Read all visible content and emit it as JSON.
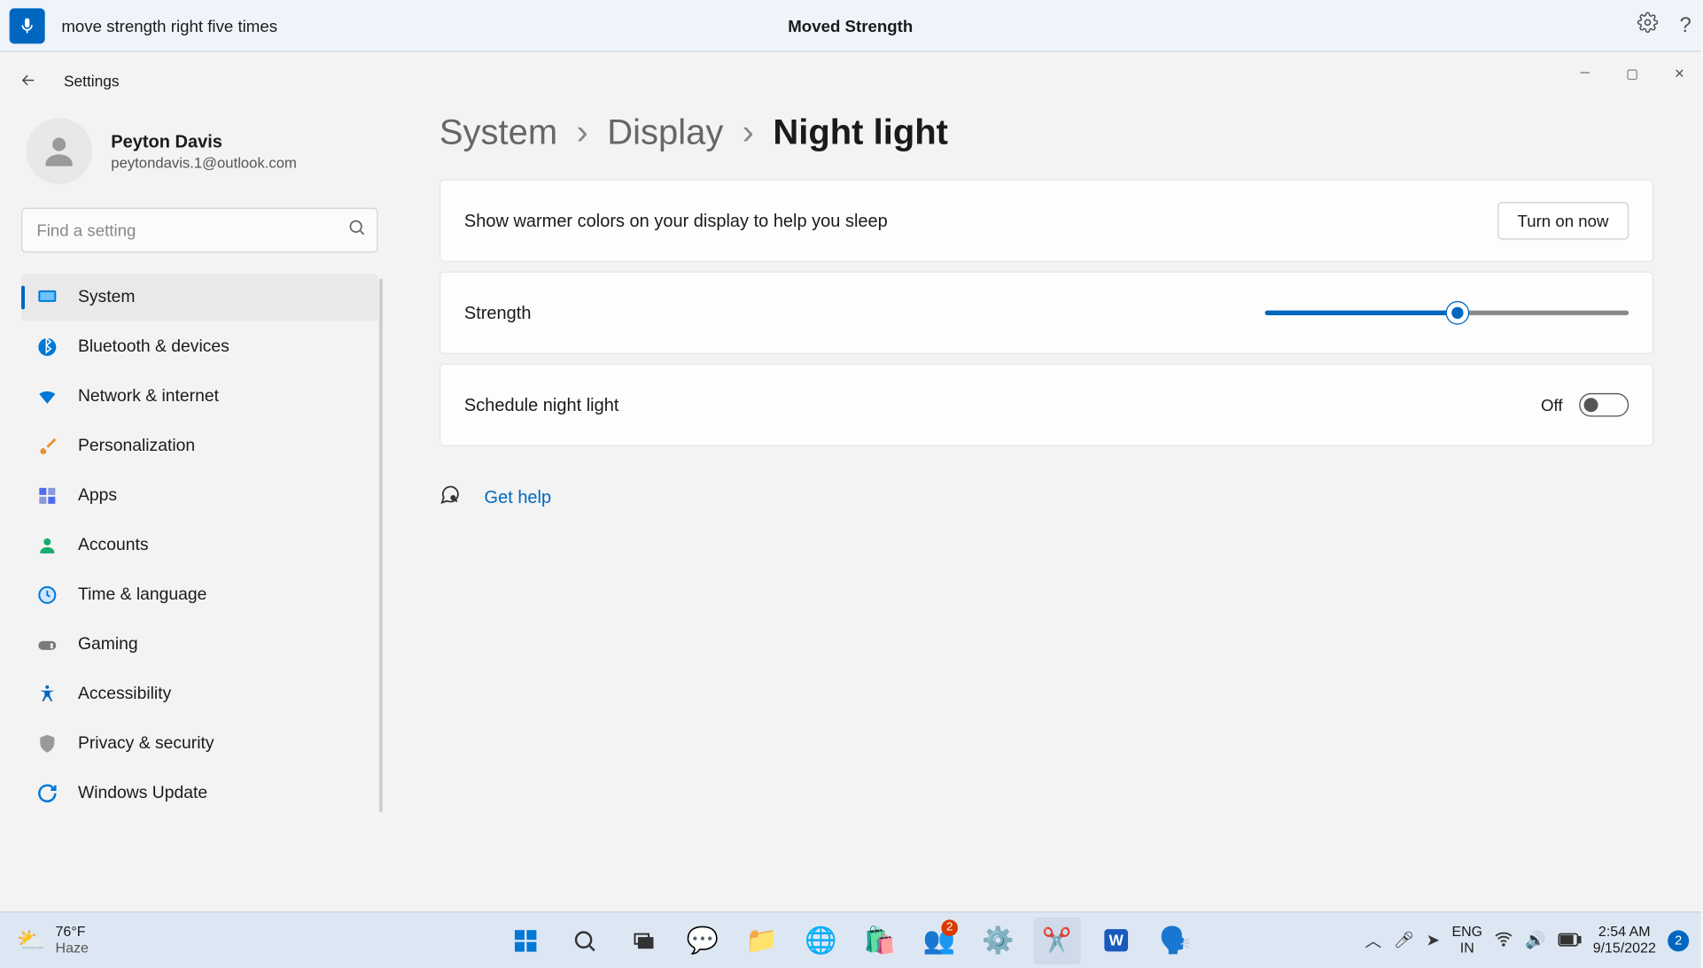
{
  "voice_bar": {
    "command": "move strength right five times",
    "result": "Moved Strength"
  },
  "window": {
    "title": "Settings",
    "breadcrumb": {
      "system": "System",
      "display": "Display",
      "current": "Night light"
    }
  },
  "profile": {
    "name": "Peyton Davis",
    "email": "peytondavis.1@outlook.com"
  },
  "search": {
    "placeholder": "Find a setting"
  },
  "sidebar": {
    "items": [
      {
        "label": "System",
        "icon": "monitor",
        "color": "#0078d4",
        "active": true
      },
      {
        "label": "Bluetooth & devices",
        "icon": "bluetooth",
        "color": "#0078d4"
      },
      {
        "label": "Network & internet",
        "icon": "wifi",
        "color": "#0078d4"
      },
      {
        "label": "Personalization",
        "icon": "brush",
        "color": "#e8912d"
      },
      {
        "label": "Apps",
        "icon": "apps",
        "color": "#4f6bed"
      },
      {
        "label": "Accounts",
        "icon": "person",
        "color": "#1aab6e"
      },
      {
        "label": "Time & language",
        "icon": "clock",
        "color": "#0078d4"
      },
      {
        "label": "Gaming",
        "icon": "gamepad",
        "color": "#7a7a7a"
      },
      {
        "label": "Accessibility",
        "icon": "accessibility",
        "color": "#0067c0"
      },
      {
        "label": "Privacy & security",
        "icon": "shield",
        "color": "#9a9a9a"
      },
      {
        "label": "Windows Update",
        "icon": "update",
        "color": "#0078d4"
      }
    ]
  },
  "cards": {
    "warm": {
      "label": "Show warmer colors on your display to help you sleep",
      "button": "Turn on now"
    },
    "strength": {
      "label": "Strength",
      "value": 53
    },
    "schedule": {
      "label": "Schedule night light",
      "state": "Off"
    }
  },
  "help": {
    "label": "Get help"
  },
  "taskbar": {
    "weather": {
      "temp": "76°F",
      "desc": "Haze"
    },
    "lang": {
      "top": "ENG",
      "bottom": "IN"
    },
    "time": "2:54 AM",
    "date": "9/15/2022",
    "notif": "2",
    "teams_badge": "2"
  }
}
